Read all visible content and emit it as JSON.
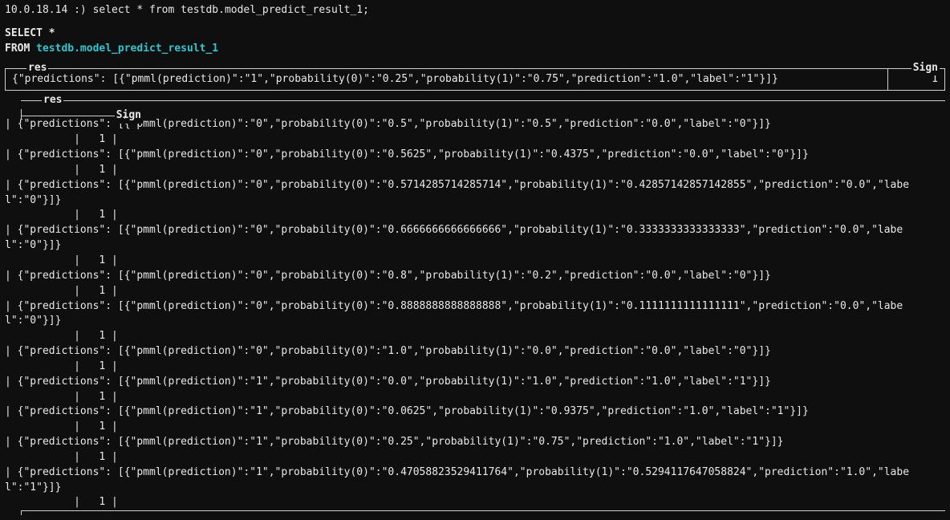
{
  "prompt": {
    "host": "10.0.18.14 :)",
    "command": "select * from testdb.model_predict_result_1;"
  },
  "sql": {
    "select_kw": "SELECT",
    "star": "*",
    "from_kw": "FROM",
    "table": "testdb.model_predict_result_1"
  },
  "cols": {
    "res": "res",
    "sign": "Sign"
  },
  "boxed_row": {
    "res": "{\"predictions\": [{\"pmml(prediction)\":\"1\",\"probability(0)\":\"0.25\",\"probability(1)\":\"0.75\",\"prediction\":\"1.0\",\"label\":\"1\"}]}",
    "sign": "1"
  },
  "rows": [
    {
      "res": "{\"predictions\": [{\"pmml(prediction)\":\"0\",\"probability(0)\":\"0.5\",\"probability(1)\":\"0.5\",\"prediction\":\"0.0\",\"label\":\"0\"}]}",
      "sign": "1"
    },
    {
      "res": "{\"predictions\": [{\"pmml(prediction)\":\"0\",\"probability(0)\":\"0.5625\",\"probability(1)\":\"0.4375\",\"prediction\":\"0.0\",\"label\":\"0\"}]}",
      "sign": "1"
    },
    {
      "res": "{\"predictions\": [{\"pmml(prediction)\":\"0\",\"probability(0)\":\"0.5714285714285714\",\"probability(1)\":\"0.42857142857142855\",\"prediction\":\"0.0\",\"label\":\"0\"}]}",
      "sign": "1"
    },
    {
      "res": "{\"predictions\": [{\"pmml(prediction)\":\"0\",\"probability(0)\":\"0.6666666666666666\",\"probability(1)\":\"0.3333333333333333\",\"prediction\":\"0.0\",\"label\":\"0\"}]}",
      "sign": "1"
    },
    {
      "res": "{\"predictions\": [{\"pmml(prediction)\":\"0\",\"probability(0)\":\"0.8\",\"probability(1)\":\"0.2\",\"prediction\":\"0.0\",\"label\":\"0\"}]}",
      "sign": "1"
    },
    {
      "res": "{\"predictions\": [{\"pmml(prediction)\":\"0\",\"probability(0)\":\"0.8888888888888888\",\"probability(1)\":\"0.1111111111111111\",\"prediction\":\"0.0\",\"label\":\"0\"}]}",
      "sign": "1"
    },
    {
      "res": "{\"predictions\": [{\"pmml(prediction)\":\"0\",\"probability(0)\":\"1.0\",\"probability(1)\":\"0.0\",\"prediction\":\"0.0\",\"label\":\"0\"}]}",
      "sign": "1"
    },
    {
      "res": "{\"predictions\": [{\"pmml(prediction)\":\"1\",\"probability(0)\":\"0.0\",\"probability(1)\":\"1.0\",\"prediction\":\"1.0\",\"label\":\"1\"}]}",
      "sign": "1"
    },
    {
      "res": "{\"predictions\": [{\"pmml(prediction)\":\"1\",\"probability(0)\":\"0.0625\",\"probability(1)\":\"0.9375\",\"prediction\":\"1.0\",\"label\":\"1\"}]}",
      "sign": "1"
    },
    {
      "res": "{\"predictions\": [{\"pmml(prediction)\":\"1\",\"probability(0)\":\"0.25\",\"probability(1)\":\"0.75\",\"prediction\":\"1.0\",\"label\":\"1\"}]}",
      "sign": "1"
    },
    {
      "res": "{\"predictions\": [{\"pmml(prediction)\":\"1\",\"probability(0)\":\"0.47058823529411764\",\"probability(1)\":\"0.5294117647058824\",\"prediction\":\"1.0\",\"label\":\"1\"}]}",
      "sign": "1"
    }
  ]
}
